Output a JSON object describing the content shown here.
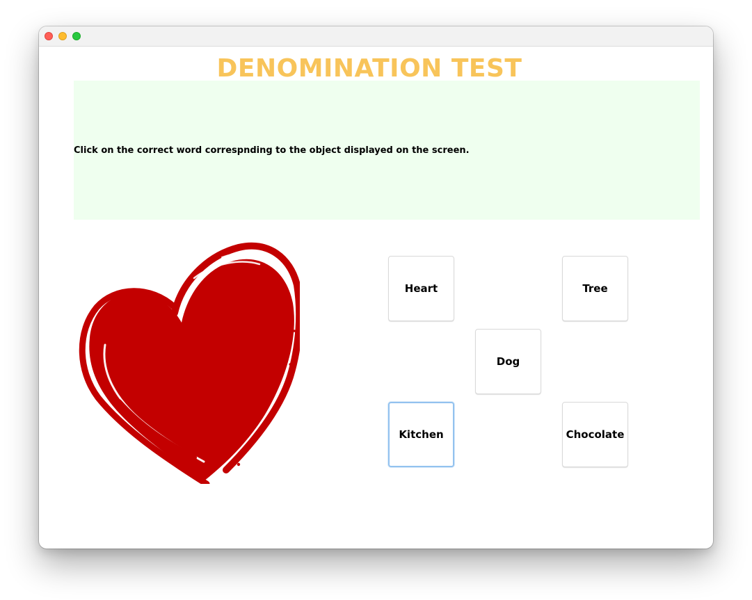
{
  "window": {
    "controls": [
      "close-icon",
      "minimize-icon",
      "zoom-icon"
    ]
  },
  "header": {
    "title": "DENOMINATION TEST",
    "instructions": "Click on the correct word correspnding to the object displayed on the screen.",
    "title_color": "#f8c45a",
    "panel_color": "#efffef"
  },
  "stimulus": {
    "image": "heart-image",
    "color": "#c30000"
  },
  "answers": {
    "heart": "Heart",
    "tree": "Tree",
    "dog": "Dog",
    "kitchen": "Kitchen",
    "chocolate": "Chocolate",
    "focused": "Kitchen"
  }
}
